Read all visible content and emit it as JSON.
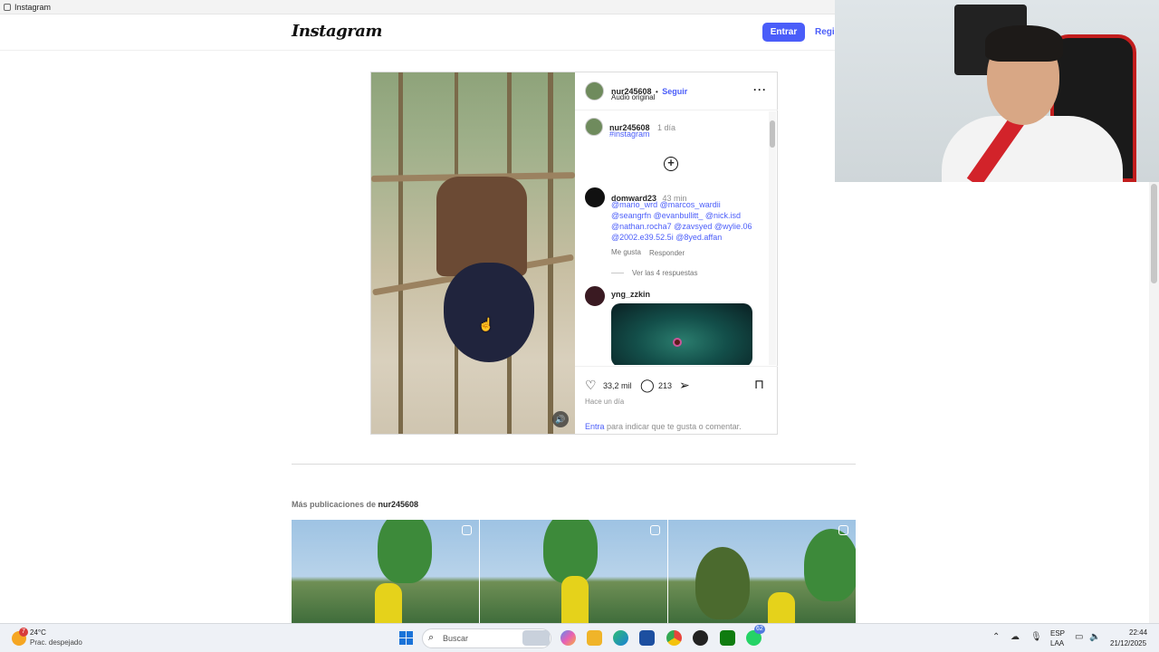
{
  "window": {
    "title": "Instagram"
  },
  "header": {
    "logo": "Instagram",
    "login_label": "Entrar",
    "register_label": "Regis"
  },
  "post": {
    "author": "nur245608",
    "follow_label": "Seguir",
    "separator": "•",
    "audio": "Audio original",
    "caption": {
      "user": "nur245608",
      "time": "1 día",
      "hashtag": "#instagram"
    },
    "comments": [
      {
        "user": "domward23",
        "time": "43 min",
        "lines": [
          "@mario_wrd @marcos_wardii",
          "@seangrfn @evanbullitt_ @nick.isd",
          "@nathan.rocha7 @zavsyed @wylie.06",
          "@2002.e39.52.5i @8yed.affan"
        ],
        "like_label": "Me gusta",
        "reply_label": "Responder",
        "view_replies": "Ver las 4 respuestas"
      },
      {
        "user": "yng_zzkin"
      }
    ],
    "likes": "33,2 mil",
    "comment_count": "213",
    "posted": "Hace un día",
    "login_prompt_link": "Entra",
    "login_prompt_rest": " para indicar que te gusta o comentar."
  },
  "more_posts": {
    "prefix": "Más publicaciones de ",
    "user": "nur245608"
  },
  "taskbar": {
    "weather_badge": "7",
    "temperature": "24°C",
    "weather_desc": "Prac. despejado",
    "search_placeholder": "Buscar",
    "whatsapp_badge": "62",
    "lang_top": "ESP",
    "lang_bottom": "LAA",
    "time": "22:44",
    "date": "21/12/2025"
  },
  "colors": {
    "accent": "#4a5df9",
    "link": "#4a5df9",
    "taskbar": "#eef1f6"
  }
}
